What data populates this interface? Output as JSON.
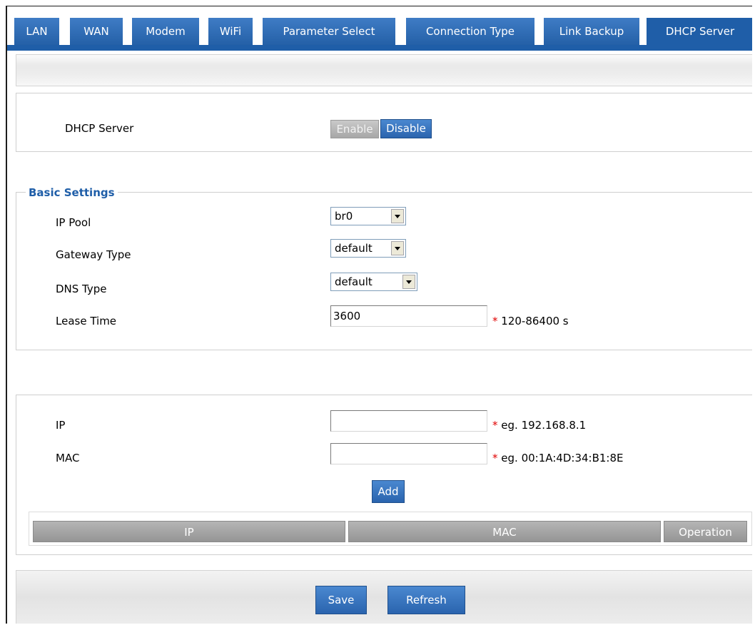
{
  "tabs": [
    {
      "label": "LAN",
      "active": false
    },
    {
      "label": "WAN",
      "active": false
    },
    {
      "label": "Modem",
      "active": false
    },
    {
      "label": "WiFi",
      "active": false
    },
    {
      "label": "Parameter Select",
      "active": false
    },
    {
      "label": "Connection Type",
      "active": false
    },
    {
      "label": "Link Backup",
      "active": false
    },
    {
      "label": "DHCP Server",
      "active": true
    }
  ],
  "dhcp": {
    "label": "DHCP Server",
    "enable_label": "Enable",
    "disable_label": "Disable",
    "state": "Disable"
  },
  "basic": {
    "legend": "Basic Settings",
    "ip_pool_label": "IP Pool",
    "ip_pool_value": "br0",
    "gateway_label": "Gateway Type",
    "gateway_value": "default",
    "dns_label": "DNS Type",
    "dns_value": "default",
    "lease_label": "Lease Time",
    "lease_value": "3600",
    "lease_hint": "120-86400 s"
  },
  "static": {
    "ip_label": "IP",
    "ip_value": "",
    "ip_hint": "eg. 192.168.8.1",
    "mac_label": "MAC",
    "mac_value": "",
    "mac_hint": "eg. 00:1A:4D:34:B1:8E",
    "add_label": "Add",
    "columns": [
      "IP",
      "MAC",
      "Operation"
    ],
    "required_mark": "*"
  },
  "footer": {
    "save_label": "Save",
    "refresh_label": "Refresh"
  },
  "colors": {
    "accent": "#1f5ea8",
    "required": "#e00000"
  }
}
